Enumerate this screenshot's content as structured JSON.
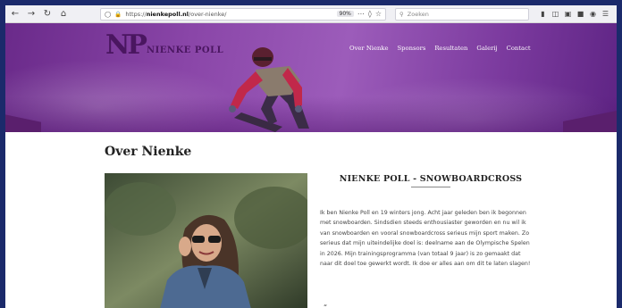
{
  "browser": {
    "url_prefix": "https://",
    "url_domain": "nienkepoll.nl",
    "url_path": "/over-nienke/",
    "zoom": "90%",
    "search_placeholder": "Zoeken"
  },
  "site": {
    "logo_mark": "NP",
    "logo_text": "NIENKE POLL",
    "nav": [
      "Over Nienke",
      "Sponsors",
      "Resultaten",
      "Galerij",
      "Contact"
    ]
  },
  "page": {
    "title": "Over Nienke",
    "section_title": "NIENKE POLL - SNOWBOARDCROSS",
    "bio": "Ik ben Nienke Poll en 19 winters jong. Acht jaar geleden ben ik begonnen met snowboarden. Sindsdien steeds enthousiaster geworden en nu wil ik van snowboarden en vooral snowboardcross serieus mijn sport maken. Zo serieus dat mijn uiteindelijke doel is: deelname aan de Olympische Spelen in 2026. Mijn trainingsprogramma (van totaal 9 jaar) is zo gemaakt dat naar dit doel toe gewerkt wordt. Ik doe er alles aan om dit te laten slagen!"
  },
  "colors": {
    "hero_purple": "#8a46a8",
    "logo_purple": "#4a1660",
    "outer_bg": "#1b2a6b"
  },
  "icons": [
    "back-icon",
    "forward-icon",
    "reload-icon",
    "home-icon",
    "shield-icon",
    "lock-icon",
    "more-icon",
    "pocket-icon",
    "star-icon",
    "search-icon",
    "library-icon",
    "sidebar-icon",
    "screenshot-icon",
    "extension-icon",
    "menu-icon"
  ]
}
